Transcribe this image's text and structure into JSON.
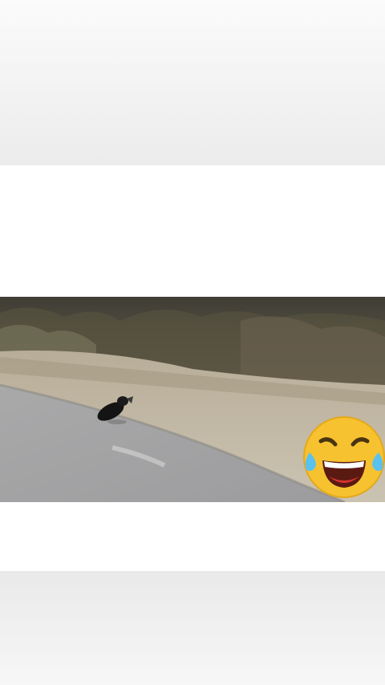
{
  "post": {
    "media": {
      "scene": "",
      "sticker": "face-with-tears-of-joy"
    }
  },
  "colors": {
    "background": "#f4f4f4",
    "card": "#ffffff",
    "road": "#a7a7a8",
    "grass": "#b7ac97",
    "trees": "#5a5447",
    "emoji_face": "#f6c230",
    "emoji_tears": "#5bc2ef",
    "emoji_mouth": "#d8332f"
  }
}
